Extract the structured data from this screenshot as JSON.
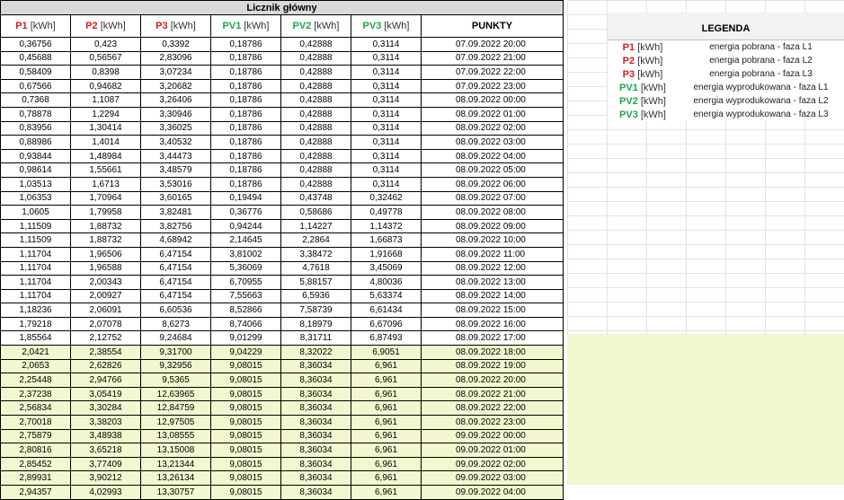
{
  "table": {
    "title": "Licznik główny",
    "unit": "[kWh]",
    "columns": [
      {
        "code": "P1",
        "color": "red"
      },
      {
        "code": "P2",
        "color": "red"
      },
      {
        "code": "P3",
        "color": "red"
      },
      {
        "code": "PV1",
        "color": "green"
      },
      {
        "code": "PV2",
        "color": "green"
      },
      {
        "code": "PV3",
        "color": "green"
      }
    ],
    "punkty_header": "PUNKTY",
    "rows": [
      [
        "0,36756",
        "0,423",
        "0,3392",
        "0,18786",
        "0,42888",
        "0,3114",
        "07.09.2022  20:00"
      ],
      [
        "0,45688",
        "0,56567",
        "2,83096",
        "0,18786",
        "0,42888",
        "0,3114",
        "07.09.2022  21:00"
      ],
      [
        "0,58409",
        "0,8398",
        "3,07234",
        "0,18786",
        "0,42888",
        "0,3114",
        "07.09.2022  22:00"
      ],
      [
        "0,67566",
        "0,94682",
        "3,20682",
        "0,18786",
        "0,42888",
        "0,3114",
        "07.09.2022  23:00"
      ],
      [
        "0,7368",
        "1,1087",
        "3,26406",
        "0,18786",
        "0,42888",
        "0,3114",
        "08.09.2022  00:00"
      ],
      [
        "0,78878",
        "1,2294",
        "3,30946",
        "0,18786",
        "0,42888",
        "0,3114",
        "08.09.2022  01:00"
      ],
      [
        "0,83956",
        "1,30414",
        "3,36025",
        "0,18786",
        "0,42888",
        "0,3114",
        "08.09.2022  02:00"
      ],
      [
        "0,88986",
        "1,4014",
        "3,40532",
        "0,18786",
        "0,42888",
        "0,3114",
        "08.09.2022  03:00"
      ],
      [
        "0,93844",
        "1,48984",
        "3,44473",
        "0,18786",
        "0,42888",
        "0,3114",
        "08.09.2022  04:00"
      ],
      [
        "0,98614",
        "1,55661",
        "3,48579",
        "0,18786",
        "0,42888",
        "0,3114",
        "08.09.2022  05:00"
      ],
      [
        "1,03513",
        "1,6713",
        "3,53016",
        "0,18786",
        "0,42888",
        "0,3114",
        "08.09.2022  06:00"
      ],
      [
        "1,06353",
        "1,70964",
        "3,60165",
        "0,19494",
        "0,43748",
        "0,32462",
        "08.09.2022  07:00"
      ],
      [
        "1,0605",
        "1,79958",
        "3,82481",
        "0,36776",
        "0,58686",
        "0,49778",
        "08.09.2022  08:00"
      ],
      [
        "1,11509",
        "1,88732",
        "3,82756",
        "0,94244",
        "1,14227",
        "1,14372",
        "08.09.2022  09:00"
      ],
      [
        "1,11509",
        "1,88732",
        "4,68942",
        "2,14645",
        "2,2864",
        "1,66873",
        "08.09.2022  10:00"
      ],
      [
        "1,11704",
        "1,96506",
        "6,47154",
        "3,81002",
        "3,38472",
        "1,91668",
        "08.09.2022  11:00"
      ],
      [
        "1,11704",
        "1,96588",
        "6,47154",
        "5,36069",
        "4,7618",
        "3,45069",
        "08.09.2022  12:00"
      ],
      [
        "1,11704",
        "2,00343",
        "6,47154",
        "6,70955",
        "5,88157",
        "4,80036",
        "08.09.2022  13:00"
      ],
      [
        "1,11704",
        "2,00927",
        "6,47154",
        "7,55663",
        "6,5936",
        "5,63374",
        "08.09.2022  14:00"
      ],
      [
        "1,18236",
        "2,06091",
        "6,60536",
        "8,52866",
        "7,58739",
        "6,61434",
        "08.09.2022  15:00"
      ],
      [
        "1,79218",
        "2,07078",
        "8,6273",
        "8,74066",
        "8,18979",
        "6,67096",
        "08.09.2022  16:00"
      ],
      [
        "1,85564",
        "2,12752",
        "9,24684",
        "9,01299",
        "8,31711",
        "6,87493",
        "08.09.2022  17:00"
      ],
      [
        "2,0421",
        "2,38554",
        "9,31700",
        "9,04229",
        "8,32022",
        "6,9051",
        "08.09.2022  18:00"
      ],
      [
        "2,0653",
        "2,62826",
        "9,32956",
        "9,08015",
        "8,36034",
        "6,961",
        "08.09.2022  19:00"
      ],
      [
        "2,25448",
        "2,94766",
        "9,5365",
        "9,08015",
        "8,36034",
        "6,961",
        "08.09.2022  20:00"
      ],
      [
        "2,37238",
        "3,05419",
        "12,63965",
        "9,08015",
        "8,36034",
        "6,961",
        "08.09.2022  21:00"
      ],
      [
        "2,56834",
        "3,30284",
        "12,84759",
        "9,08015",
        "8,36034",
        "6,961",
        "08.09.2022  22:00"
      ],
      [
        "2,70018",
        "3,38203",
        "12,97505",
        "9,08015",
        "8,36034",
        "6,961",
        "08.09.2022  23:00"
      ],
      [
        "2,75879",
        "3,48938",
        "13,08555",
        "9,08015",
        "8,36034",
        "6,961",
        "09.09.2022  00:00"
      ],
      [
        "2,80816",
        "3,65218",
        "13,15008",
        "9,08015",
        "8,36034",
        "6,961",
        "09.09.2022  01:00"
      ],
      [
        "2,85452",
        "3,77409",
        "13,21344",
        "9,08015",
        "8,36034",
        "6,961",
        "09.09.2022  02:00"
      ],
      [
        "2,89931",
        "3,90212",
        "13,26134",
        "9,08015",
        "8,36034",
        "6,961",
        "09.09.2022  03:00"
      ],
      [
        "2,94357",
        "4,02993",
        "13,30757",
        "9,08015",
        "8,36034",
        "6,961",
        "09.09.2022  04:00"
      ]
    ],
    "highlight_from_row": 22,
    "highlight_color": "#f2f7cf"
  },
  "legend": {
    "title": "LEGENDA",
    "items": [
      {
        "code": "P1",
        "unit": "[kWh]",
        "color": "red",
        "desc": "energia pobrana - faza L1"
      },
      {
        "code": "P2",
        "unit": "[kWh]",
        "color": "red",
        "desc": "energia pobrana - faza L2"
      },
      {
        "code": "P3",
        "unit": "[kWh]",
        "color": "red",
        "desc": "energia pobrana - faza L3"
      },
      {
        "code": "PV1",
        "unit": "[kWh]",
        "color": "green",
        "desc": "energia wyprodukowana - faza L1"
      },
      {
        "code": "PV2",
        "unit": "[kWh]",
        "color": "green",
        "desc": "energia wyprodukowana - faza L2"
      },
      {
        "code": "PV3",
        "unit": "[kWh]",
        "color": "green",
        "desc": "energia wyprodukowana - faza L3"
      }
    ]
  },
  "colors": {
    "red": "#d61c1c",
    "green": "#19a84a"
  }
}
